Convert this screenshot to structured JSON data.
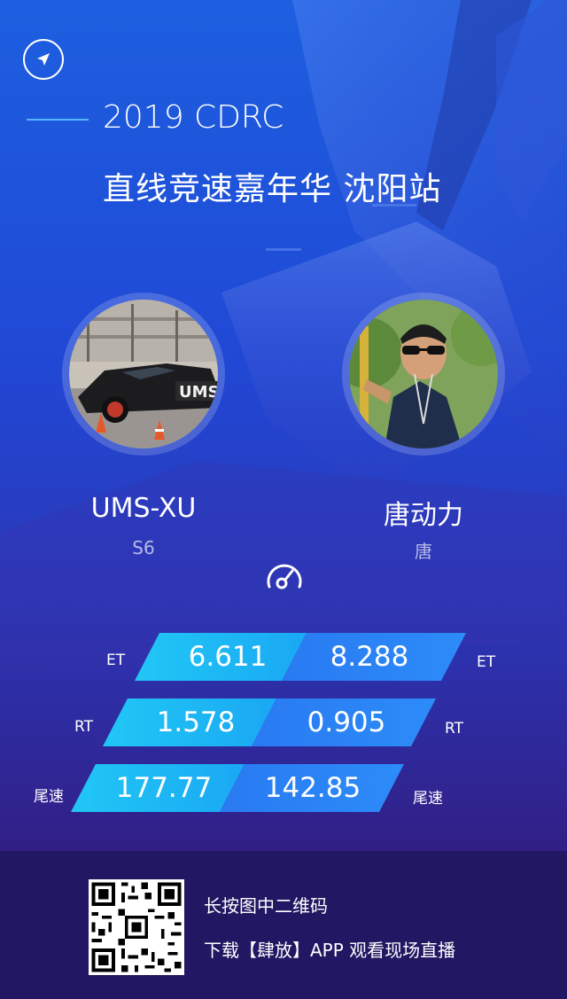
{
  "header": {
    "title_line1": "2019 CDRC",
    "title_line2": "直线竞速嘉年华 沈阳站"
  },
  "icons": {
    "nav": "navigation-arrow-icon",
    "gauge": "speedometer-icon"
  },
  "players": {
    "left": {
      "name": "UMS-XU",
      "car": "S6"
    },
    "right": {
      "name": "唐动力",
      "car": "唐"
    }
  },
  "stats": [
    {
      "label_left": "ET",
      "left": "6.611",
      "right": "8.288",
      "label_right": "ET"
    },
    {
      "label_left": "RT",
      "left": "1.578",
      "right": "0.905",
      "label_right": "RT"
    },
    {
      "label_left": "尾速",
      "left": "177.77",
      "right": "142.85",
      "label_right": "尾速"
    }
  ],
  "footer": {
    "line1": "长按图中二维码",
    "line2": "下载【肆放】APP 观看现场直播"
  },
  "colors": {
    "bar_left": "#1fb8f5",
    "bar_right": "#2b80f5",
    "footer_bg": "#211762",
    "accent_line": "#58b6ff"
  }
}
